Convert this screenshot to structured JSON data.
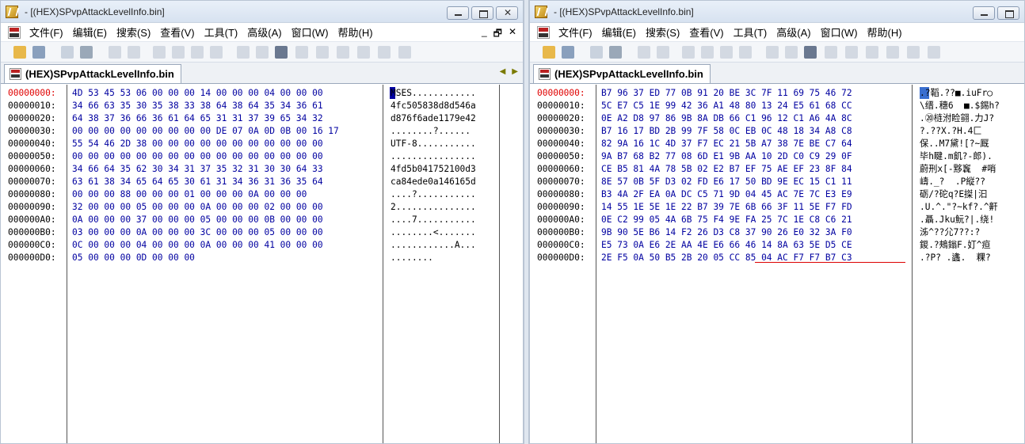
{
  "left": {
    "title": "- [(HEX)SPvpAttackLevelInfo.bin]",
    "menus": [
      "文件(F)",
      "编辑(E)",
      "搜索(S)",
      "查看(V)",
      "工具(T)",
      "高级(A)",
      "窗口(W)",
      "帮助(H)"
    ],
    "mdi_controls": [
      "_",
      "🗗",
      "✕"
    ],
    "tab_label": "(HEX)SPvpAttackLevelInfo.bin",
    "tab_arrows": [
      "◀",
      "▶"
    ],
    "addresses": [
      "00000000:",
      "00000010:",
      "00000020:",
      "00000030:",
      "00000040:",
      "00000050:",
      "00000060:",
      "00000070:",
      "00000080:",
      "00000090:",
      "000000A0:",
      "000000B0:",
      "000000C0:",
      "000000D0:"
    ],
    "hex_rows": [
      "4D 53 45 53 06 00 00 00 14 00 00 00 04 00 00 00",
      "34 66 63 35 30 35 38 33 38 64 38 64 35 34 36 61",
      "64 38 37 36 66 36 61 64 65 31 31 37 39 65 34 32",
      "00 00 00 00 00 00 00 00 00 DE 07 0A 0D 0B 00 16 17",
      "55 54 46 2D 38 00 00 00 00 00 00 00 00 00 00 00",
      "00 00 00 00 00 00 00 00 00 00 00 00 00 00 00 00",
      "34 66 64 35 62 30 34 31 37 35 32 31 30 30 64 33",
      "63 61 38 34 65 64 65 30 61 31 34 36 31 36 35 64",
      "00 00 00 88 00 00 00 01 00 00 00 0A 00 00 00",
      "32 00 00 00 05 00 00 00 0A 00 00 00 02 00 00 00",
      "0A 00 00 00 37 00 00 00 05 00 00 00 0B 00 00 00",
      "03 00 00 00 0A 00 00 00 3C 00 00 00 05 00 00 00",
      "0C 00 00 00 04 00 00 00 0A 00 00 00 41 00 00 00",
      "05 00 00 00 0D 00 00 00"
    ],
    "ascii_rows": [
      "MSES............",
      "4fc505838d8d546a",
      "d876f6ade1179e42",
      "........?......",
      "UTF-8...........",
      "................",
      "4fd5b041752100d3",
      "ca84ede0a146165d",
      "....?...........",
      "2...............",
      "....7...........",
      "........<.......",
      "............A...",
      "........"
    ]
  },
  "right": {
    "title": "- [(HEX)SPvpAttackLevelInfo.bin]",
    "menus": [
      "文件(F)",
      "编辑(E)",
      "搜索(S)",
      "查看(V)",
      "工具(T)",
      "高级(A)",
      "窗口(W)",
      "帮助(H)"
    ],
    "tab_label": "(HEX)SPvpAttackLevelInfo.bin",
    "addresses": [
      "00000000:",
      "00000010:",
      "00000020:",
      "00000030:",
      "00000040:",
      "00000050:",
      "00000060:",
      "00000070:",
      "00000080:",
      "00000090:",
      "000000A0:",
      "000000B0:",
      "000000C0:",
      "000000D0:"
    ],
    "hex_rows": [
      "B7 96 37 ED 77 0B 91 20 BE 3C 7F 11 69 75 46 72",
      "5C E7 C5 1E 99 42 36 A1 48 80 13 24 E5 61 68 CC",
      "0E A2 D8 97 86 9B 8A DB 66 C1 96 12 C1 A6 4A 8C",
      "B7 16 17 BD 2B 99 7F 58 0C EB 0C 48 18 34 A8 C8",
      "82 9A 16 1C 4D 37 F7 EC 21 5B A7 38 7E BE C7 64",
      "9A B7 68 B2 77 08 6D E1 9B AA 10 2D C0 C9 29 0F",
      "CE B5 81 4A 78 5B 02 E2 B7 EF 75 AE EF 23 8F 84",
      "8E 57 0B 5F D3 02 FD E6 17 50 BD 9E EC 15 C1 11",
      "B3 4A 2F EA 0A DC C5 71 9D 04 45 AC 7E 7C E3 E9",
      "14 55 1E 5E 1E 22 B7 39 7E 6B 66 3F 11 5E F7 FD",
      "0E C2 99 05 4A 6B 75 F4 9E FA 25 7C 1E C8 C6 21",
      "9B 90 5E B6 14 F2 26 D3 C8 37 90 26 E0 32 3A F0",
      "E5 73 0A E6 2E AA 4E E6 66 46 14 8A 63 5E D5 CE",
      "2E F5 0A 50 B5 2B 20 05 CC 85 04 AC F7 F7 B7 C3"
    ],
    "ascii_rows": [
      ".?鞱.??■.iuFr◯",
      "\\缙.穗6  ■.$錫h?",
      ".⑳梿泭睑翧.力J?",
      "?.??X.?H.4匚",
      "保..M7黛![?~厩",
      "毕h睷.m飢?-郎).",
      "蔚刑x[-黟竁  #哨",
      "嶹._?  .P縦??",
      "砺/?砣q?E搩|汩",
      ".U.^.\"?~kf?.^鼾",
      ".聶.Jku魭?|.绕!",
      "泲^??尣7??:?",
      "鍐.?鵊鎓F.奵^疸",
      ".?P? .蠭.  粿?"
    ]
  }
}
